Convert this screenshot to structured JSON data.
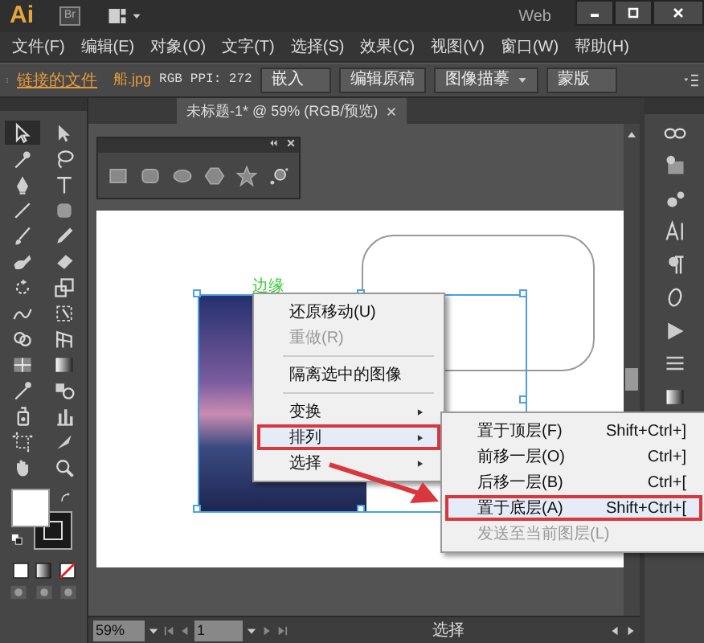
{
  "title_bar": {
    "logo": "Ai",
    "bridge": "Br",
    "workspace": "Web"
  },
  "menu_bar": [
    "文件(F)",
    "编辑(E)",
    "对象(O)",
    "文字(T)",
    "选择(S)",
    "效果(C)",
    "视图(V)",
    "窗口(W)",
    "帮助(H)"
  ],
  "control_bar": {
    "link_label": "链接的文件",
    "file_name": "船.jpg",
    "color_mode": "RGB",
    "ppi": "PPI: 272",
    "buttons": [
      {
        "label": "嵌入",
        "dropdown": false
      },
      {
        "label": "编辑原稿",
        "dropdown": false
      },
      {
        "label": "图像描摹",
        "dropdown": true
      },
      {
        "label": "蒙版",
        "dropdown": false
      }
    ]
  },
  "document_tab": {
    "title": "未标题-1* @ 59% (RGB/预览)"
  },
  "canvas": {
    "object_label": "边缘"
  },
  "context_menu": {
    "items": [
      {
        "kind": "item",
        "label": "还原移动(U)",
        "disabled": false,
        "selected": false,
        "has_submenu": false
      },
      {
        "kind": "item",
        "label": "重做(R)",
        "disabled": true,
        "selected": false,
        "has_submenu": false
      },
      {
        "kind": "separator"
      },
      {
        "kind": "item",
        "label": "隔离选中的图像",
        "disabled": false,
        "selected": false,
        "has_submenu": false
      },
      {
        "kind": "separator"
      },
      {
        "kind": "item",
        "label": "变换",
        "disabled": false,
        "selected": false,
        "has_submenu": true
      },
      {
        "kind": "item",
        "label": "排列",
        "disabled": false,
        "selected": true,
        "has_submenu": true
      },
      {
        "kind": "item",
        "label": "选择",
        "disabled": false,
        "selected": false,
        "has_submenu": true
      }
    ]
  },
  "submenu": {
    "items": [
      {
        "label": "置于顶层(F)",
        "shortcut": "Shift+Ctrl+]",
        "disabled": false,
        "selected": false
      },
      {
        "label": "前移一层(O)",
        "shortcut": "Ctrl+]",
        "disabled": false,
        "selected": false
      },
      {
        "label": "后移一层(B)",
        "shortcut": "Ctrl+[",
        "disabled": false,
        "selected": false
      },
      {
        "label": "置于底层(A)",
        "shortcut": "Shift+Ctrl+[",
        "disabled": false,
        "selected": true
      },
      {
        "label": "发送至当前图层(L)",
        "disabled": true,
        "selected": false
      }
    ]
  },
  "status_bar": {
    "zoom": "59%",
    "artboard": "1",
    "tool": "选择"
  }
}
